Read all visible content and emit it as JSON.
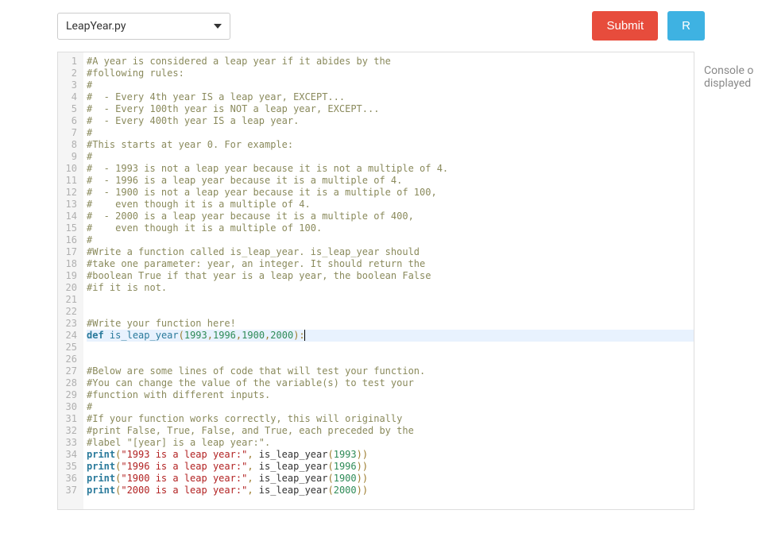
{
  "toolbar": {
    "file_selected": "LeapYear.py",
    "submit_label": "Submit",
    "run_label": "R"
  },
  "console": {
    "line1": "Console o",
    "line2": "displayed"
  },
  "editor": {
    "current_line": 24,
    "lines": [
      {
        "n": 1,
        "type": "comment",
        "text": "#A year is considered a leap year if it abides by the"
      },
      {
        "n": 2,
        "type": "comment",
        "text": "#following rules:"
      },
      {
        "n": 3,
        "type": "comment",
        "text": "#"
      },
      {
        "n": 4,
        "type": "comment",
        "text": "#  - Every 4th year IS a leap year, EXCEPT..."
      },
      {
        "n": 5,
        "type": "comment",
        "text": "#  - Every 100th year is NOT a leap year, EXCEPT..."
      },
      {
        "n": 6,
        "type": "comment",
        "text": "#  - Every 400th year IS a leap year."
      },
      {
        "n": 7,
        "type": "comment",
        "text": "#"
      },
      {
        "n": 8,
        "type": "comment",
        "text": "#This starts at year 0. For example:"
      },
      {
        "n": 9,
        "type": "comment",
        "text": "#"
      },
      {
        "n": 10,
        "type": "comment",
        "text": "#  - 1993 is not a leap year because it is not a multiple of 4."
      },
      {
        "n": 11,
        "type": "comment",
        "text": "#  - 1996 is a leap year because it is a multiple of 4."
      },
      {
        "n": 12,
        "type": "comment",
        "text": "#  - 1900 is not a leap year because it is a multiple of 100,"
      },
      {
        "n": 13,
        "type": "comment",
        "text": "#    even though it is a multiple of 4."
      },
      {
        "n": 14,
        "type": "comment",
        "text": "#  - 2000 is a leap year because it is a multiple of 400,"
      },
      {
        "n": 15,
        "type": "comment",
        "text": "#    even though it is a multiple of 100."
      },
      {
        "n": 16,
        "type": "comment",
        "text": "#"
      },
      {
        "n": 17,
        "type": "comment",
        "text": "#Write a function called is_leap_year. is_leap_year should"
      },
      {
        "n": 18,
        "type": "comment",
        "text": "#take one parameter: year, an integer. It should return the"
      },
      {
        "n": 19,
        "type": "comment",
        "text": "#boolean True if that year is a leap year, the boolean False"
      },
      {
        "n": 20,
        "type": "comment",
        "text": "#if it is not."
      },
      {
        "n": 21,
        "type": "blank",
        "text": ""
      },
      {
        "n": 22,
        "type": "blank",
        "text": ""
      },
      {
        "n": 23,
        "type": "comment",
        "text": "#Write your function here!"
      },
      {
        "n": 24,
        "type": "def",
        "kw": "def",
        "fn": "is_leap_year",
        "args": [
          "1993",
          "1996",
          "1900",
          "2000"
        ],
        "text_after": ":"
      },
      {
        "n": 25,
        "type": "blank",
        "text": ""
      },
      {
        "n": 26,
        "type": "blank",
        "text": ""
      },
      {
        "n": 27,
        "type": "comment",
        "text": "#Below are some lines of code that will test your function."
      },
      {
        "n": 28,
        "type": "comment",
        "text": "#You can change the value of the variable(s) to test your"
      },
      {
        "n": 29,
        "type": "comment",
        "text": "#function with different inputs."
      },
      {
        "n": 30,
        "type": "comment",
        "text": "#"
      },
      {
        "n": 31,
        "type": "comment",
        "text": "#If your function works correctly, this will originally"
      },
      {
        "n": 32,
        "type": "comment",
        "text": "#print False, True, False, and True, each preceded by the"
      },
      {
        "n": 33,
        "type": "comment",
        "text": "#label \"[year] is a leap year:\"."
      },
      {
        "n": 34,
        "type": "print",
        "kw": "print",
        "str": "\"1993 is a leap year:\"",
        "call": "is_leap_year",
        "arg": "1993"
      },
      {
        "n": 35,
        "type": "print",
        "kw": "print",
        "str": "\"1996 is a leap year:\"",
        "call": "is_leap_year",
        "arg": "1996"
      },
      {
        "n": 36,
        "type": "print",
        "kw": "print",
        "str": "\"1900 is a leap year:\"",
        "call": "is_leap_year",
        "arg": "1900"
      },
      {
        "n": 37,
        "type": "print",
        "kw": "print",
        "str": "\"2000 is a leap year:\"",
        "call": "is_leap_year",
        "arg": "2000"
      }
    ]
  }
}
